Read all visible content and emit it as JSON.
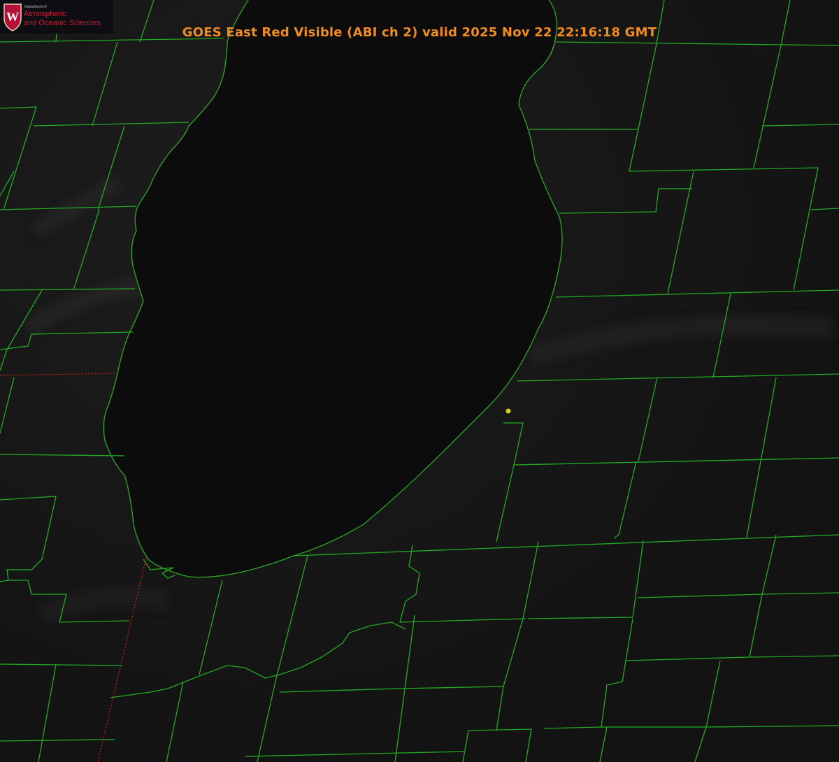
{
  "title": "GOES East Red Visible (ABI ch 2) valid 2025 Nov 22 22:16:18 GMT",
  "logo": {
    "department": "Department of",
    "line1": "Atmospheric",
    "line2": "and Oceanic Sciences",
    "crest_letter": "W"
  },
  "colors": {
    "background": "#111111",
    "lake": "#0c0c0c",
    "title": "#f08c20",
    "county_lines": "#22aa22",
    "state_line": "#d02020",
    "marker": "#d8cc20",
    "logo_text": "#c41e3a",
    "crest": "#b5103a"
  }
}
